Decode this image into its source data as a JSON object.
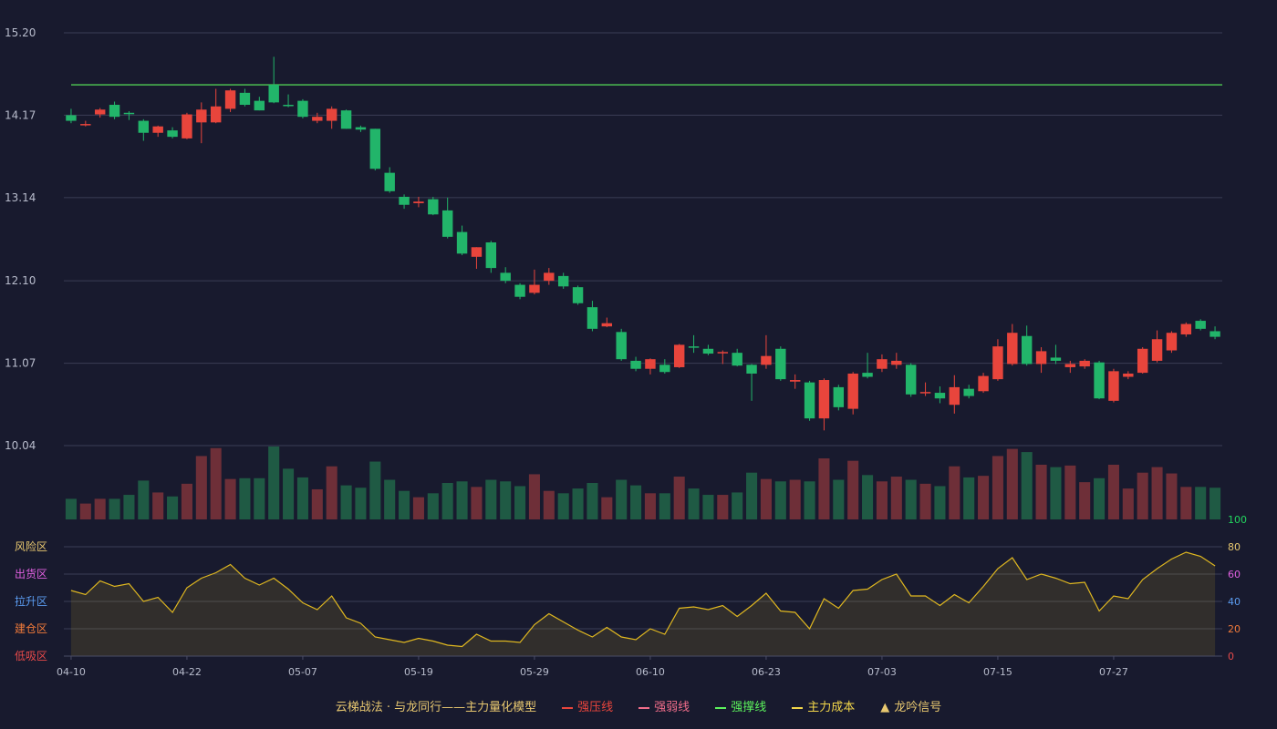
{
  "chart_data": {
    "type": "candlestick",
    "price_axis": {
      "min": 10.04,
      "max": 15.2,
      "ticks": [
        "15.20",
        "14.17",
        "13.14",
        "12.10",
        "11.07",
        "10.04"
      ]
    },
    "indicator_axis": {
      "min": 0,
      "max": 100,
      "ticks": [
        100,
        80,
        60,
        40,
        20,
        0
      ],
      "tick_colors": [
        "#22d45e",
        "#e8c870",
        "#e060e0",
        "#5b9cf0",
        "#f07a3a",
        "#e84a4a"
      ]
    },
    "zones": [
      {
        "label": "风险区",
        "color": "#e8c870"
      },
      {
        "label": "出货区",
        "color": "#e060e0"
      },
      {
        "label": "拉升区",
        "color": "#5b9cf0"
      },
      {
        "label": "建仓区",
        "color": "#f07a3a"
      },
      {
        "label": "低吸区",
        "color": "#e84a4a"
      }
    ],
    "x_ticks": [
      {
        "index": 0,
        "label": "04-10"
      },
      {
        "index": 8,
        "label": "04-22"
      },
      {
        "index": 16,
        "label": "05-07"
      },
      {
        "index": 24,
        "label": "05-19"
      },
      {
        "index": 32,
        "label": "05-29"
      },
      {
        "index": 40,
        "label": "06-10"
      },
      {
        "index": 48,
        "label": "06-23"
      },
      {
        "index": 56,
        "label": "07-03"
      },
      {
        "index": 64,
        "label": "07-15"
      },
      {
        "index": 72,
        "label": "07-27"
      }
    ],
    "resistance_level": 14.55,
    "colors": {
      "up": "#e8453c",
      "down": "#22b56a",
      "vol_up": "#6e2f38",
      "vol_down": "#1f5a44",
      "resistance": "#5cf25c",
      "indicator": "#e0b820"
    },
    "ohlc": [
      [
        14.17,
        14.1,
        14.25,
        14.07
      ],
      [
        14.05,
        14.06,
        14.1,
        14.03
      ],
      [
        14.18,
        14.24,
        14.26,
        14.14
      ],
      [
        14.3,
        14.15,
        14.34,
        14.12
      ],
      [
        14.2,
        14.19,
        14.22,
        14.11
      ],
      [
        14.1,
        13.95,
        14.12,
        13.85
      ],
      [
        13.95,
        14.03,
        14.04,
        13.9
      ],
      [
        13.98,
        13.9,
        14.02,
        13.88
      ],
      [
        13.88,
        14.18,
        14.2,
        13.87
      ],
      [
        14.08,
        14.24,
        14.33,
        13.82
      ],
      [
        14.08,
        14.28,
        14.5,
        14.07
      ],
      [
        14.25,
        14.48,
        14.5,
        14.21
      ],
      [
        14.45,
        14.3,
        14.5,
        14.28
      ],
      [
        14.35,
        14.23,
        14.4,
        14.23
      ],
      [
        14.55,
        14.33,
        14.9,
        14.32
      ],
      [
        14.3,
        14.29,
        14.43,
        14.27
      ],
      [
        14.35,
        14.15,
        14.37,
        14.13
      ],
      [
        14.1,
        14.15,
        14.2,
        14.07
      ],
      [
        14.1,
        14.25,
        14.28,
        14.0
      ],
      [
        14.23,
        14.0,
        14.24,
        14.0
      ],
      [
        14.02,
        13.99,
        14.04,
        13.96
      ],
      [
        14.0,
        13.5,
        14.0,
        13.48
      ],
      [
        13.45,
        13.22,
        13.52,
        13.2
      ],
      [
        13.15,
        13.05,
        13.18,
        13.0
      ],
      [
        13.07,
        13.09,
        13.15,
        13.02
      ],
      [
        13.12,
        12.93,
        13.15,
        12.92
      ],
      [
        12.98,
        12.65,
        13.14,
        12.63
      ],
      [
        12.71,
        12.44,
        12.79,
        12.42
      ],
      [
        12.4,
        12.52,
        12.52,
        12.25
      ],
      [
        12.58,
        12.26,
        12.6,
        12.2
      ],
      [
        12.2,
        12.1,
        12.27,
        12.07
      ],
      [
        12.05,
        11.9,
        12.07,
        11.87
      ],
      [
        11.95,
        12.05,
        12.24,
        11.93
      ],
      [
        12.1,
        12.2,
        12.26,
        12.05
      ],
      [
        12.16,
        12.03,
        12.2,
        12.0
      ],
      [
        12.02,
        11.82,
        12.04,
        11.8
      ],
      [
        11.77,
        11.5,
        11.85,
        11.47
      ],
      [
        11.53,
        11.57,
        11.64,
        11.52
      ],
      [
        11.46,
        11.12,
        11.5,
        11.1
      ],
      [
        11.1,
        11.0,
        11.15,
        10.97
      ],
      [
        11.0,
        11.12,
        11.13,
        10.93
      ],
      [
        11.05,
        10.96,
        11.12,
        10.94
      ],
      [
        11.02,
        11.3,
        11.31,
        11.01
      ],
      [
        11.28,
        11.27,
        11.42,
        11.2
      ],
      [
        11.25,
        11.19,
        11.3,
        11.17
      ],
      [
        11.2,
        11.21,
        11.23,
        11.06
      ],
      [
        11.2,
        11.04,
        11.25,
        11.03
      ],
      [
        11.05,
        10.94,
        11.06,
        10.6
      ],
      [
        11.05,
        11.16,
        11.42,
        11.0
      ],
      [
        11.25,
        10.87,
        11.28,
        10.85
      ],
      [
        10.84,
        10.86,
        10.93,
        10.75
      ],
      [
        10.83,
        10.38,
        10.85,
        10.35
      ],
      [
        10.38,
        10.86,
        10.88,
        10.23
      ],
      [
        10.77,
        10.52,
        10.8,
        10.48
      ],
      [
        10.5,
        10.94,
        10.96,
        10.43
      ],
      [
        10.95,
        10.9,
        11.2,
        10.88
      ],
      [
        11.0,
        11.12,
        11.18,
        10.96
      ],
      [
        11.05,
        11.1,
        11.2,
        11.0
      ],
      [
        11.05,
        10.68,
        11.07,
        10.65
      ],
      [
        10.7,
        10.71,
        10.83,
        10.66
      ],
      [
        10.7,
        10.63,
        10.78,
        10.57
      ],
      [
        10.55,
        10.77,
        10.92,
        10.44
      ],
      [
        10.75,
        10.66,
        10.8,
        10.63
      ],
      [
        10.72,
        10.91,
        10.95,
        10.7
      ],
      [
        10.87,
        11.28,
        11.37,
        10.85
      ],
      [
        11.06,
        11.45,
        11.56,
        11.04
      ],
      [
        11.41,
        11.06,
        11.54,
        11.04
      ],
      [
        11.06,
        11.22,
        11.27,
        10.95
      ],
      [
        11.14,
        11.1,
        11.3,
        11.06
      ],
      [
        11.02,
        11.06,
        11.1,
        10.95
      ],
      [
        11.03,
        11.1,
        11.12,
        11.0
      ],
      [
        11.08,
        10.63,
        11.1,
        10.62
      ],
      [
        10.6,
        10.97,
        11.0,
        10.58
      ],
      [
        10.9,
        10.94,
        10.97,
        10.87
      ],
      [
        10.95,
        11.25,
        11.27,
        10.94
      ],
      [
        11.1,
        11.37,
        11.48,
        11.08
      ],
      [
        11.23,
        11.45,
        11.47,
        11.2
      ],
      [
        11.43,
        11.56,
        11.58,
        11.4
      ],
      [
        11.6,
        11.5,
        11.62,
        11.48
      ],
      [
        11.47,
        11.4,
        11.53,
        11.37
      ]
    ],
    "volume": [
      26,
      20,
      26,
      26,
      31,
      49,
      34,
      29,
      45,
      80,
      90,
      51,
      52,
      52,
      92,
      64,
      53,
      38,
      67,
      43,
      40,
      73,
      50,
      36,
      28,
      33,
      46,
      48,
      41,
      50,
      48,
      42,
      57,
      36,
      33,
      39,
      46,
      28,
      50,
      43,
      33,
      33,
      54,
      39,
      31,
      31,
      34,
      59,
      51,
      48,
      50,
      48,
      77,
      50,
      74,
      56,
      48,
      54,
      50,
      45,
      42,
      67,
      53,
      55,
      80,
      89,
      85,
      69,
      66,
      68,
      47,
      52,
      69,
      39,
      59,
      66,
      58,
      41,
      41,
      40
    ],
    "indicator": [
      48,
      45,
      55,
      51,
      53,
      40,
      43,
      32,
      50,
      57,
      61,
      67,
      57,
      52,
      57,
      49,
      39,
      34,
      44,
      28,
      24,
      14,
      12,
      10,
      13,
      11,
      8,
      7,
      16,
      11,
      11,
      10,
      23,
      31,
      25,
      19,
      14,
      21,
      14,
      12,
      20,
      16,
      35,
      36,
      34,
      37,
      29,
      37,
      46,
      33,
      32,
      20,
      42,
      35,
      48,
      49,
      56,
      60,
      44,
      44,
      37,
      45,
      39,
      51,
      64,
      72,
      56,
      60,
      57,
      53,
      54,
      33,
      44,
      42,
      56,
      64,
      71,
      76,
      73,
      66
    ]
  },
  "legend": [
    {
      "label": "云梯战法 · 与龙同行——主力量化模型",
      "swatch": "none",
      "color": "#e8c870"
    },
    {
      "label": "强压线",
      "swatch": "solid",
      "color": "#e8453c"
    },
    {
      "label": "强弱线",
      "swatch": "dashed",
      "color": "#f06d8a"
    },
    {
      "label": "强撑线",
      "swatch": "solid",
      "color": "#5cf25c"
    },
    {
      "label": "主力成本",
      "swatch": "dashed",
      "color": "#f2d64a"
    },
    {
      "label": "龙吟信号",
      "swatch": "triangle",
      "color": "#e8c870"
    }
  ]
}
